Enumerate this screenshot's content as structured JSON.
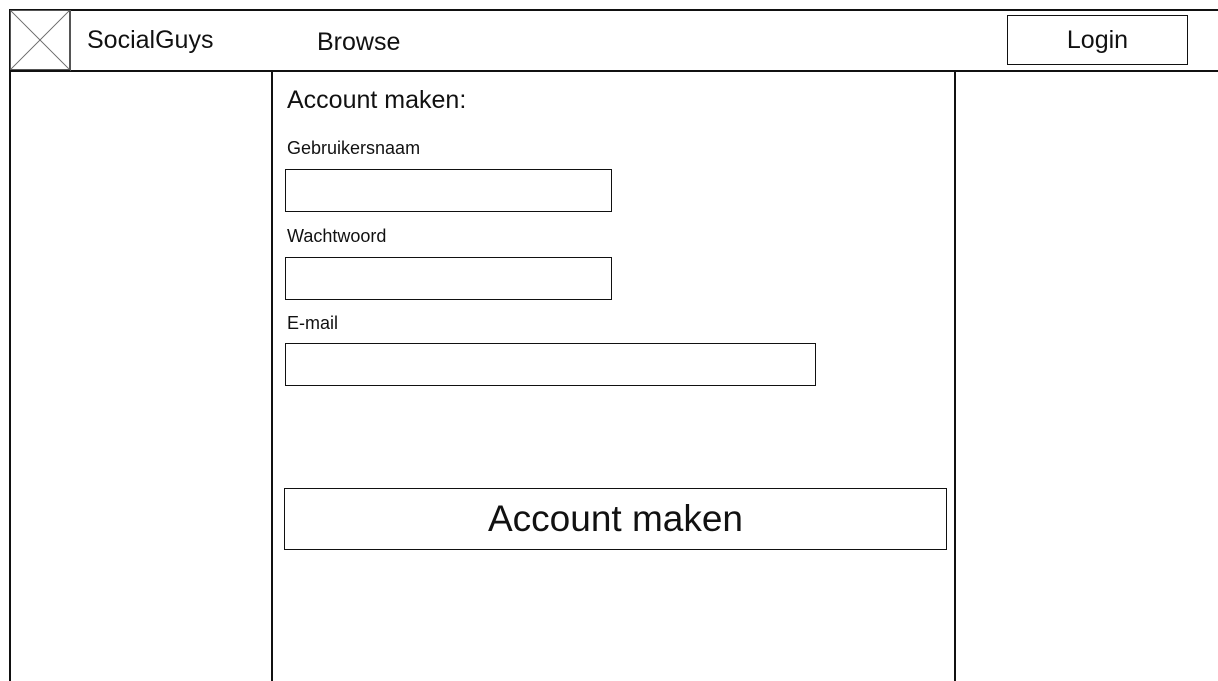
{
  "header": {
    "brand": "SocialGuys",
    "nav_browse": "Browse",
    "login_label": "Login",
    "logo_icon": "image-placeholder-icon"
  },
  "form": {
    "title": "Account maken:",
    "username_label": "Gebruikersnaam",
    "username_value": "",
    "password_label": "Wachtwoord",
    "password_value": "",
    "email_label": "E-mail",
    "email_value": "",
    "submit_label": "Account maken"
  },
  "colors": {
    "line": "#111111",
    "background": "#ffffff"
  }
}
